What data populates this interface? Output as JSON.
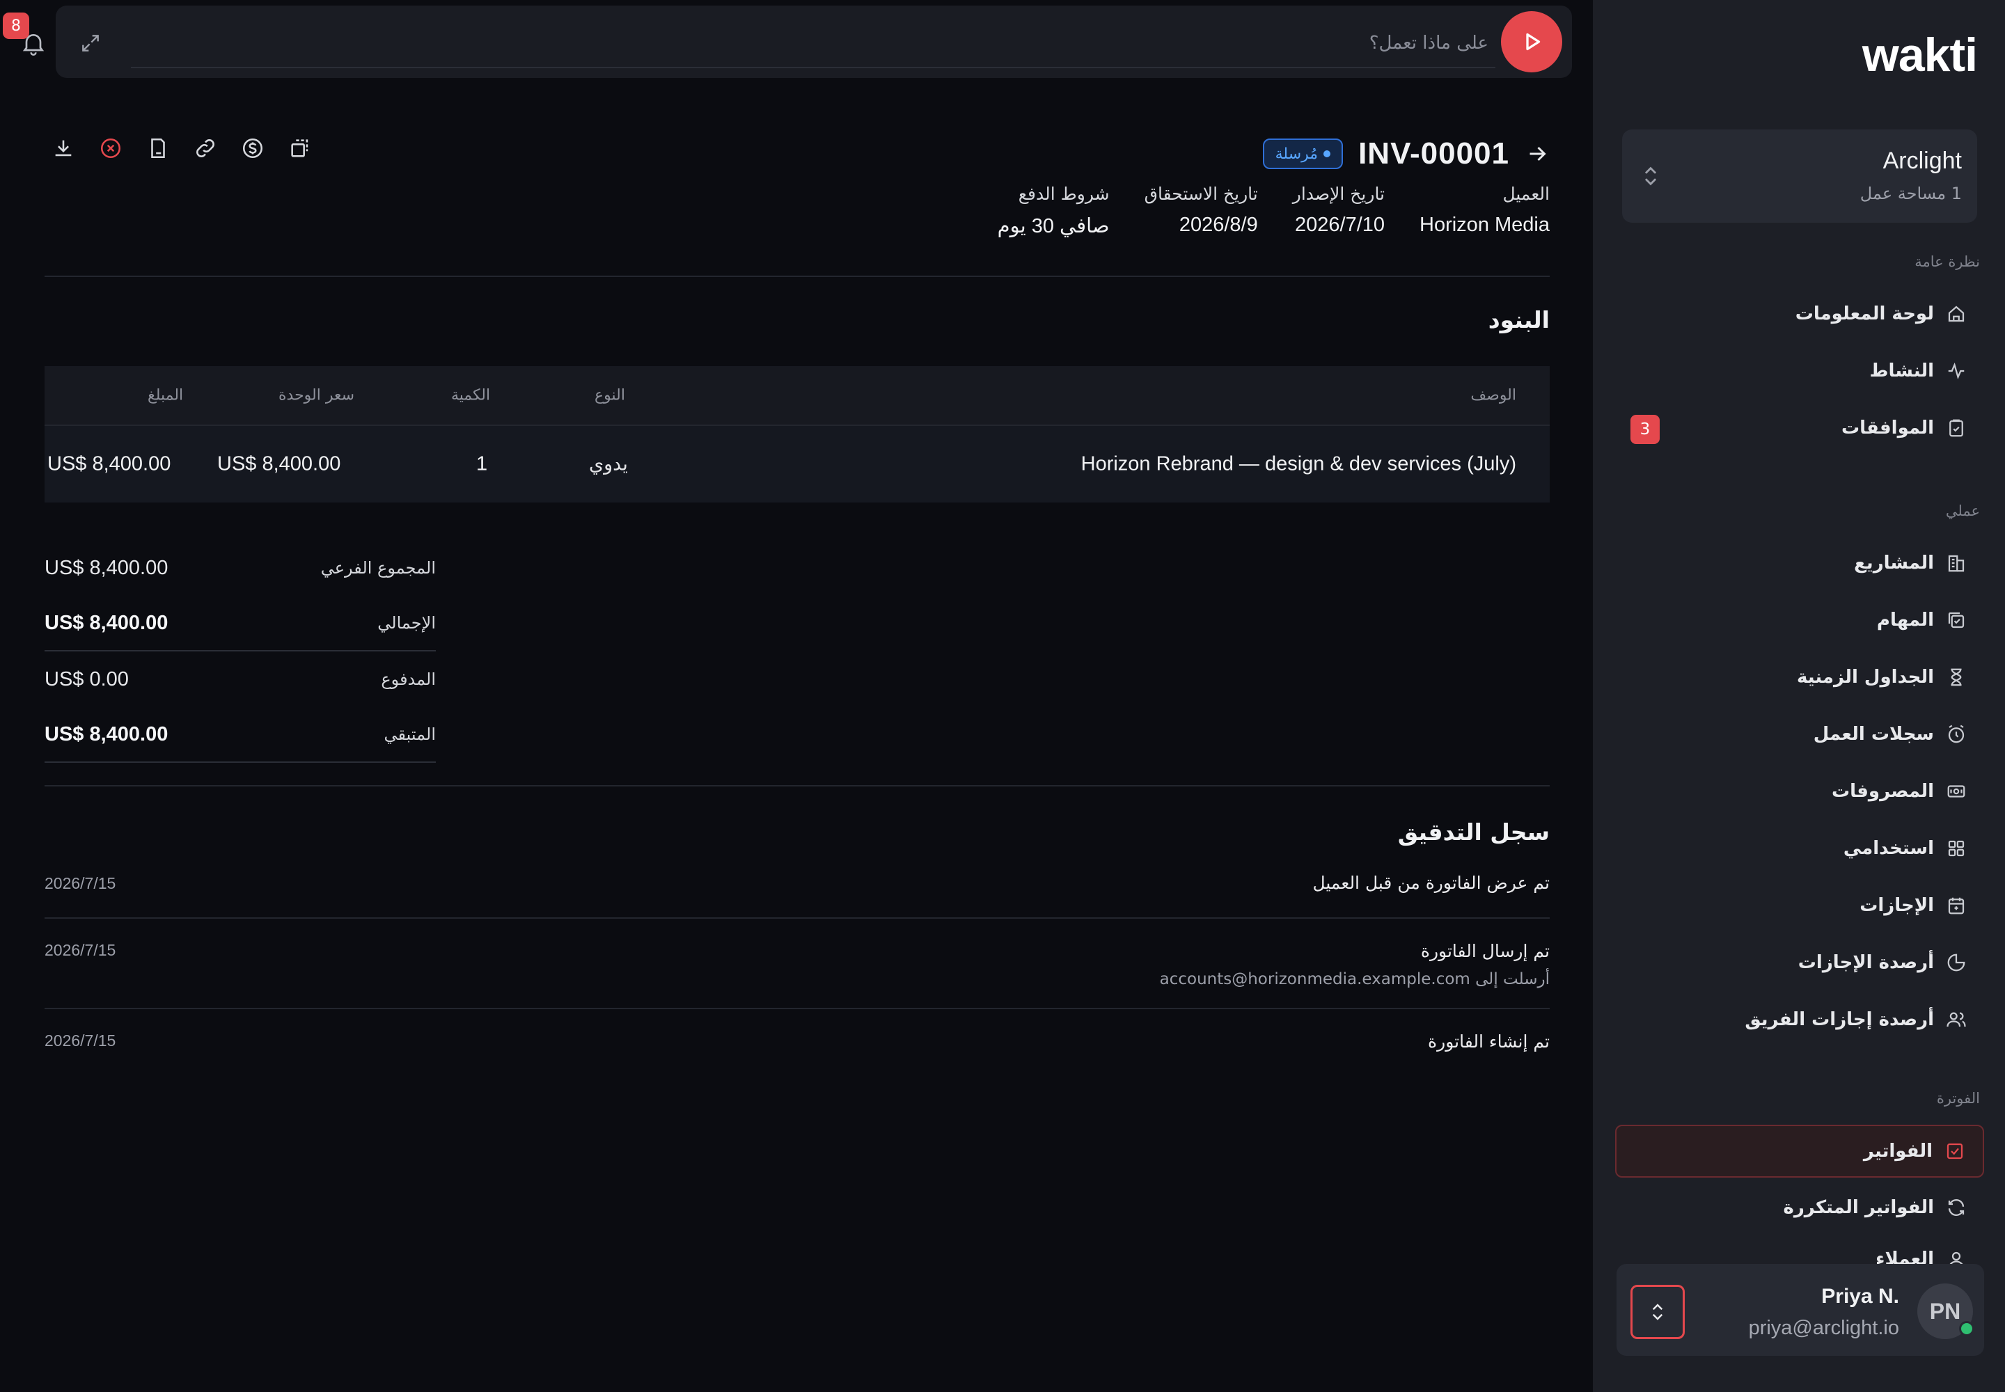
{
  "topbar": {
    "notification_count": "8",
    "command_placeholder": "على ماذا تعمل؟"
  },
  "invoice": {
    "number": "INV-00001",
    "status": "مُرسلة",
    "meta": [
      {
        "label": "العميل",
        "value": "Horizon Media"
      },
      {
        "label": "تاريخ الإصدار",
        "value": "2026/7/10"
      },
      {
        "label": "تاريخ الاستحقاق",
        "value": "2026/8/9"
      },
      {
        "label": "شروط الدفع",
        "value": "صافي 30 يوم"
      }
    ],
    "items_title": "البنود",
    "columns": {
      "description": "الوصف",
      "type": "النوع",
      "quantity": "الكمية",
      "unit_price": "سعر الوحدة",
      "amount": "المبلغ"
    },
    "items": [
      {
        "description": "Horizon Rebrand — design & dev services (July)",
        "type": "يدوي",
        "quantity": "1",
        "unit_price": "US$ 8,400.00",
        "amount": "US$ 8,400.00"
      }
    ],
    "totals": [
      {
        "label": "المجموع الفرعي",
        "value": "US$ 8,400.00"
      },
      {
        "label": "الإجمالي",
        "value": "US$ 8,400.00"
      },
      {
        "label": "المدفوع",
        "value": "US$ 0.00"
      },
      {
        "label": "المتبقي",
        "value": "US$ 8,400.00"
      }
    ],
    "audit_title": "سجل التدقيق",
    "audit": [
      {
        "title": "تم عرض الفاتورة من قبل العميل",
        "sub": "",
        "date": "2026/7/15"
      },
      {
        "title": "تم إرسال الفاتورة",
        "sub": "أرسلت إلى accounts@horizonmedia.example.com",
        "date": "2026/7/15"
      },
      {
        "title": "تم إنشاء الفاتورة",
        "sub": "",
        "date": "2026/7/15"
      }
    ]
  },
  "sidebar": {
    "logo": "wakti",
    "workspace": {
      "name": "Arclight",
      "count": "1 مساحة عمل"
    },
    "sections": {
      "overview": "نظرة عامة",
      "work": "عملي",
      "billing": "الفوترة"
    },
    "items": [
      {
        "label": "لوحة المعلومات",
        "icon": "home-icon"
      },
      {
        "label": "النشاط",
        "icon": "activity-icon"
      },
      {
        "label": "الموافقات",
        "icon": "clipboard-check-icon",
        "badge": "3"
      },
      {
        "label": "المشاريع",
        "icon": "building-icon"
      },
      {
        "label": "المهام",
        "icon": "tasks-icon"
      },
      {
        "label": "الجداول الزمنية",
        "icon": "hourglass-icon"
      },
      {
        "label": "سجلات العمل",
        "icon": "alarm-clock-icon"
      },
      {
        "label": "المصروفات",
        "icon": "banknote-icon"
      },
      {
        "label": "استخدامي",
        "icon": "grid-icon"
      },
      {
        "label": "الإجازات",
        "icon": "calendar-icon"
      },
      {
        "label": "أرصدة الإجازات",
        "icon": "pie-chart-icon"
      },
      {
        "label": "أرصدة إجازات الفريق",
        "icon": "users-icon"
      },
      {
        "label": "الفواتير",
        "icon": "invoice-check-icon",
        "active": true
      },
      {
        "label": "الفواتير المتكررة",
        "icon": "refresh-icon"
      },
      {
        "label": "العملاء",
        "icon": "user-icon"
      }
    ],
    "user": {
      "initials": "PN",
      "name": "Priya N.",
      "email": "priya@arclight.io"
    }
  },
  "colors": {
    "accent": "#e5484d",
    "status_blue": "#58a6ff",
    "online": "#2fbf71"
  }
}
